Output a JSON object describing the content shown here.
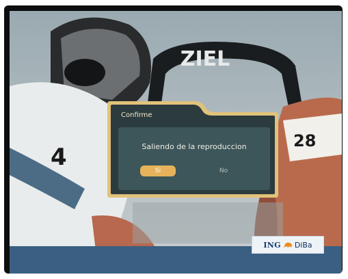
{
  "screen": {
    "banner_text": "ZIEL",
    "runner_bibs": [
      "4",
      "28"
    ]
  },
  "dialog": {
    "title": "Confirme",
    "message": "Saliendo de la reproduccion",
    "yes_label": "Si",
    "no_label": "No"
  },
  "brand": {
    "name_part1": "ING",
    "name_part2": "DiBa",
    "icon": "lion-icon"
  },
  "colors": {
    "dialog_border": "#e2c27a",
    "dialog_body": "#3d5659",
    "selected_button": "#e6b35a",
    "bottom_bar": "#3a5f82"
  }
}
